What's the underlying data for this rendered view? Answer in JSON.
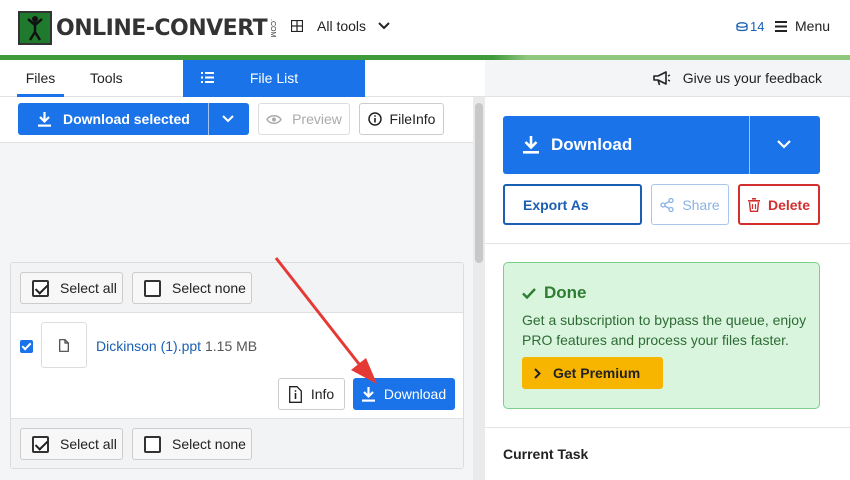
{
  "header": {
    "logo_text": "ONLINE-CONVERT",
    "logo_suffix": ".COM",
    "all_tools_label": "All tools",
    "credits": "14",
    "menu_label": "Menu"
  },
  "tabs": {
    "files": "Files",
    "tools": "Tools",
    "file_list": "File List"
  },
  "toolbar": {
    "download_selected": "Download selected",
    "preview": "Preview",
    "fileinfo": "FileInfo"
  },
  "file_list": {
    "select_all": "Select all",
    "select_none": "Select none",
    "files": [
      {
        "name": "Dickinson (1).ppt",
        "size": "1.15 MB",
        "checked": true
      }
    ],
    "info_label": "Info",
    "download_label": "Download"
  },
  "right": {
    "feedback": "Give us your feedback",
    "download": "Download",
    "export_as": "Export As",
    "share": "Share",
    "delete": "Delete",
    "done_title": "Done",
    "done_text": "Get a subscription to bypass the queue, enjoy PRO features and process your files faster.",
    "premium": "Get Premium",
    "current_task": "Current Task"
  },
  "colors": {
    "primary": "#1a73e8",
    "brand_green": "#3f9a3a",
    "done_bg": "#d9f5de",
    "done_text": "#2e7d32",
    "premium": "#f7b500",
    "delete": "#d32f2f",
    "arrow": "#e53935"
  }
}
